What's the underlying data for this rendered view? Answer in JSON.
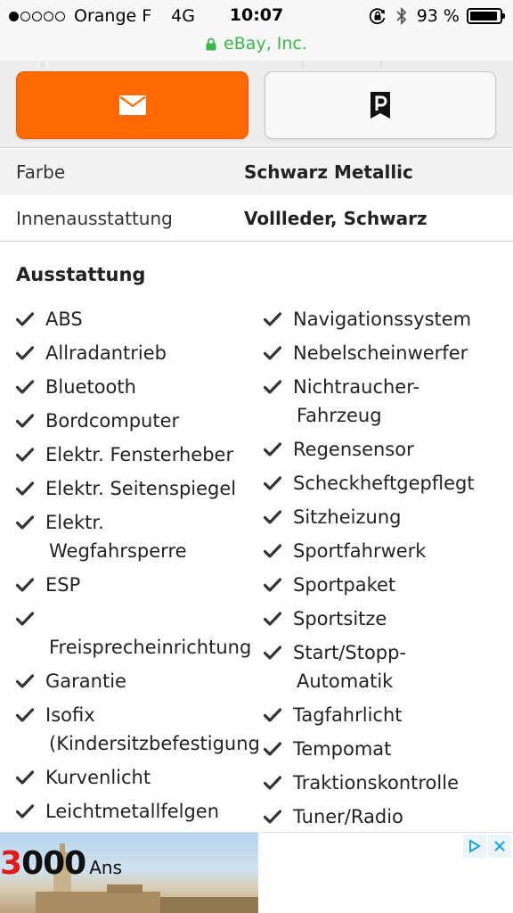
{
  "status_bar": {
    "carrier": "Orange F",
    "network": "4G",
    "time": "10:07",
    "battery_percent": "93 %",
    "battery_level": 0.93,
    "signal_bars_filled": 1,
    "signal_bars_total": 5
  },
  "url_bar": {
    "site": "eBay, Inc.",
    "secure_color": "#3cb54a"
  },
  "actions": {
    "mail_icon": "envelope-icon",
    "park_icon": "parking-icon",
    "accent": "#ff6a00"
  },
  "details": [
    {
      "label": "Farbe",
      "value": "Schwarz Metallic"
    },
    {
      "label": "Innenausstattung",
      "value": "Vollleder, Schwarz"
    }
  ],
  "equipment": {
    "title": "Ausstattung",
    "left": [
      "ABS",
      "Allradantrieb",
      "Bluetooth",
      "Bordcomputer",
      "Elektr. Fensterheber",
      "Elektr. Seitenspiegel",
      "Elektr.\nWegfahrsperre",
      "ESP",
      "\nFreisprecheinrichtung",
      "Garantie",
      "Isofix\n(Kindersitzbefestigung)",
      "Kurvenlicht",
      "Leichtmetallfelgen"
    ],
    "right": [
      "Navigationssystem",
      "Nebelscheinwerfer",
      "Nichtraucher-\nFahrzeug",
      "Regensensor",
      "Scheckheftgepflegt",
      "Sitzheizung",
      "Sportfahrwerk",
      "Sportpaket",
      "Sportsitze",
      "Start/Stopp-\nAutomatik",
      "Tagfahrlicht",
      "Tempomat",
      "Traktionskontrolle",
      "Tuner/Radio"
    ]
  },
  "ad": {
    "number_red": "3",
    "number_black": "000",
    "unit": "Ans",
    "controls": [
      "adchoices-icon",
      "close-icon"
    ]
  }
}
